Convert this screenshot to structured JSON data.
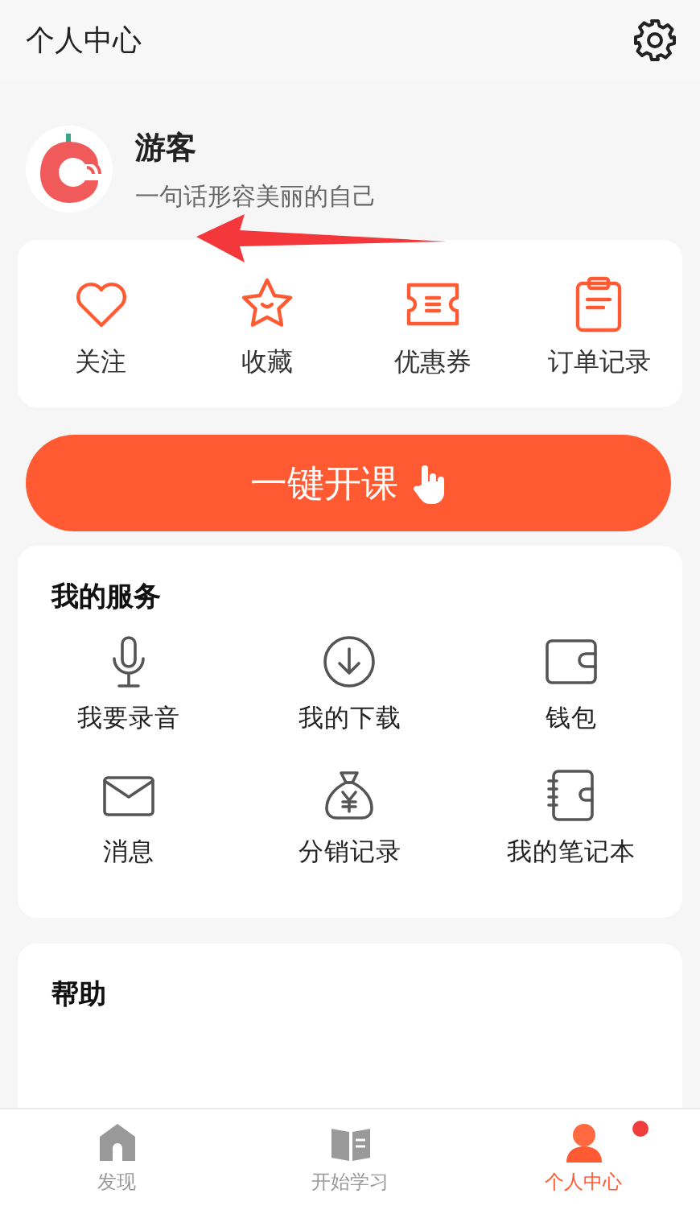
{
  "header": {
    "title": "个人中心"
  },
  "profile": {
    "name": "游客",
    "motto": "一句话形容美丽的自己"
  },
  "quick_links": [
    {
      "kind": "heart",
      "label": "关注"
    },
    {
      "kind": "star",
      "label": "收藏"
    },
    {
      "kind": "ticket",
      "label": "优惠券"
    },
    {
      "kind": "clipboard",
      "label": "订单记录"
    }
  ],
  "cta_button": {
    "label": "一键开课"
  },
  "services": {
    "title": "我的服务",
    "items": [
      {
        "kind": "mic",
        "label": "我要录音"
      },
      {
        "kind": "download",
        "label": "我的下载"
      },
      {
        "kind": "wallet",
        "label": "钱包"
      },
      {
        "kind": "mail",
        "label": "消息"
      },
      {
        "kind": "moneybag",
        "label": "分销记录"
      },
      {
        "kind": "notebook",
        "label": "我的笔记本"
      }
    ]
  },
  "help": {
    "title": "帮助"
  },
  "tab_bar": [
    {
      "kind": "home",
      "label": "发现",
      "selected": false,
      "dot": false
    },
    {
      "kind": "book",
      "label": "开始学习",
      "selected": false,
      "dot": false
    },
    {
      "kind": "person",
      "label": "个人中心",
      "selected": true,
      "dot": true
    }
  ]
}
